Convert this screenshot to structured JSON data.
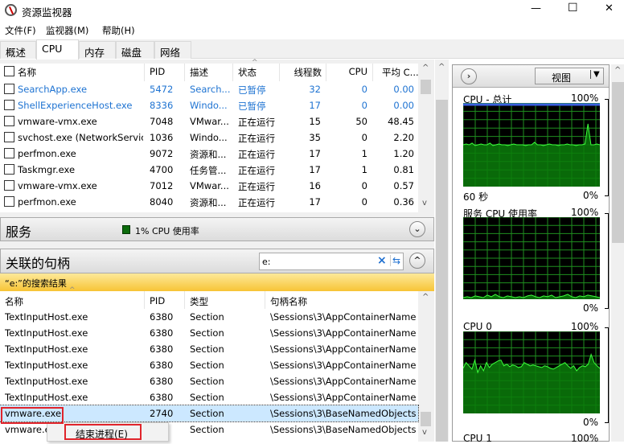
{
  "window": {
    "title": "资源监视器",
    "minimize": "—",
    "maximize": "☐",
    "close": "✕"
  },
  "menu": [
    "文件(F)",
    "监视器(M)",
    "帮助(H)"
  ],
  "tabs": [
    "概述",
    "CPU",
    "内存",
    "磁盘",
    "网络"
  ],
  "processes": {
    "headers": [
      "名称",
      "PID",
      "描述",
      "状态",
      "线程数",
      "CPU",
      "平均 C..."
    ],
    "rows": [
      {
        "name": "SearchApp.exe",
        "pid": "5472",
        "desc": "Search...",
        "status": "已暂停",
        "threads": "32",
        "cpu": "0",
        "avg": "0.00",
        "suspended": true
      },
      {
        "name": "ShellExperienceHost.exe",
        "pid": "8336",
        "desc": "Windo...",
        "status": "已暂停",
        "threads": "17",
        "cpu": "0",
        "avg": "0.00",
        "suspended": true
      },
      {
        "name": "vmware-vmx.exe",
        "pid": "7048",
        "desc": "VMwar...",
        "status": "正在运行",
        "threads": "15",
        "cpu": "50",
        "avg": "48.45"
      },
      {
        "name": "svchost.exe (NetworkService)",
        "pid": "1036",
        "desc": "Windo...",
        "status": "正在运行",
        "threads": "35",
        "cpu": "0",
        "avg": "2.20"
      },
      {
        "name": "perfmon.exe",
        "pid": "9072",
        "desc": "资源和...",
        "status": "正在运行",
        "threads": "17",
        "cpu": "1",
        "avg": "1.20"
      },
      {
        "name": "Taskmgr.exe",
        "pid": "4700",
        "desc": "任务管...",
        "status": "正在运行",
        "threads": "17",
        "cpu": "1",
        "avg": "0.81"
      },
      {
        "name": "vmware-vmx.exe",
        "pid": "7012",
        "desc": "VMwar...",
        "status": "正在运行",
        "threads": "16",
        "cpu": "0",
        "avg": "0.57"
      },
      {
        "name": "perfmon.exe",
        "pid": "8040",
        "desc": "资源和...",
        "status": "正在运行",
        "threads": "17",
        "cpu": "0",
        "avg": "0.36"
      }
    ]
  },
  "services": {
    "title": "服务",
    "usage": "1% CPU 使用率"
  },
  "handles": {
    "title": "关联的句柄",
    "search_value": "e:",
    "clear": "×",
    "results_label": "“e:”的搜索结果",
    "headers": [
      "名称",
      "PID",
      "类型",
      "句柄名称"
    ],
    "rows": [
      {
        "name": "TextInputHost.exe",
        "pid": "6380",
        "type": "Section",
        "handle": "\\Sessions\\3\\AppContainerName..."
      },
      {
        "name": "TextInputHost.exe",
        "pid": "6380",
        "type": "Section",
        "handle": "\\Sessions\\3\\AppContainerName..."
      },
      {
        "name": "TextInputHost.exe",
        "pid": "6380",
        "type": "Section",
        "handle": "\\Sessions\\3\\AppContainerName..."
      },
      {
        "name": "TextInputHost.exe",
        "pid": "6380",
        "type": "Section",
        "handle": "\\Sessions\\3\\AppContainerName..."
      },
      {
        "name": "TextInputHost.exe",
        "pid": "6380",
        "type": "Section",
        "handle": "\\Sessions\\3\\AppContainerName..."
      },
      {
        "name": "TextInputHost.exe",
        "pid": "6380",
        "type": "Section",
        "handle": "\\Sessions\\3\\AppContainerName..."
      },
      {
        "name": "vmware.exe",
        "pid": "2740",
        "type": "Section",
        "handle": "\\Sessions\\3\\BaseNamedObjects...",
        "selected": true
      },
      {
        "name": "vmware.exe",
        "pid": "",
        "type": "Section",
        "handle": "\\Sessions\\3\\BaseNamedObjects..."
      }
    ]
  },
  "context_menu": {
    "end_process": "结束进程(E)"
  },
  "right_panel": {
    "view_label": "视图",
    "graphs": [
      {
        "title": "CPU - 总计",
        "max": "100%",
        "min": "0%",
        "time": "60 秒",
        "max_line": true,
        "values": [
          50,
          51,
          50,
          52,
          49,
          50,
          51,
          50,
          50,
          52,
          49,
          50,
          51,
          50,
          50,
          49,
          50,
          51,
          50,
          50,
          50,
          49,
          50,
          50,
          53,
          50,
          50,
          49,
          50,
          51,
          50,
          50,
          49,
          50,
          50,
          51,
          50,
          50,
          49,
          50,
          50,
          51,
          75,
          50,
          50,
          51,
          50
        ]
      },
      {
        "title": "服务 CPU 使用率",
        "max": "100%",
        "min": "0%",
        "values": [
          2,
          3,
          2,
          4,
          3,
          2,
          5,
          3,
          6,
          3,
          2,
          4,
          3,
          2,
          3,
          2,
          4,
          5,
          3,
          2,
          4,
          3,
          5,
          2,
          3,
          4,
          6,
          3,
          2,
          4,
          3,
          5,
          4,
          3,
          2
        ]
      },
      {
        "title": "CPU 0",
        "max": "100%",
        "min": "0%",
        "values": [
          55,
          62,
          58,
          54,
          65,
          50,
          58,
          52,
          62,
          56,
          60,
          62,
          64,
          65,
          58,
          60,
          57,
          59,
          58,
          56,
          57,
          62,
          60,
          58,
          59,
          58,
          57,
          56,
          58,
          57,
          55,
          54,
          56,
          58,
          60,
          62,
          58,
          55,
          58,
          52,
          56,
          58,
          57,
          60,
          72,
          62,
          58,
          55
        ]
      },
      {
        "title": "CPU 1",
        "max": "100%"
      }
    ]
  },
  "colors": {
    "graph_bg": "#000000",
    "graph_grid": "#1f8f1f",
    "graph_fill": "#0a7d0a",
    "graph_line": "#3cff3c",
    "suspended": "#1e73d2",
    "highlight": "#ffd65c"
  }
}
